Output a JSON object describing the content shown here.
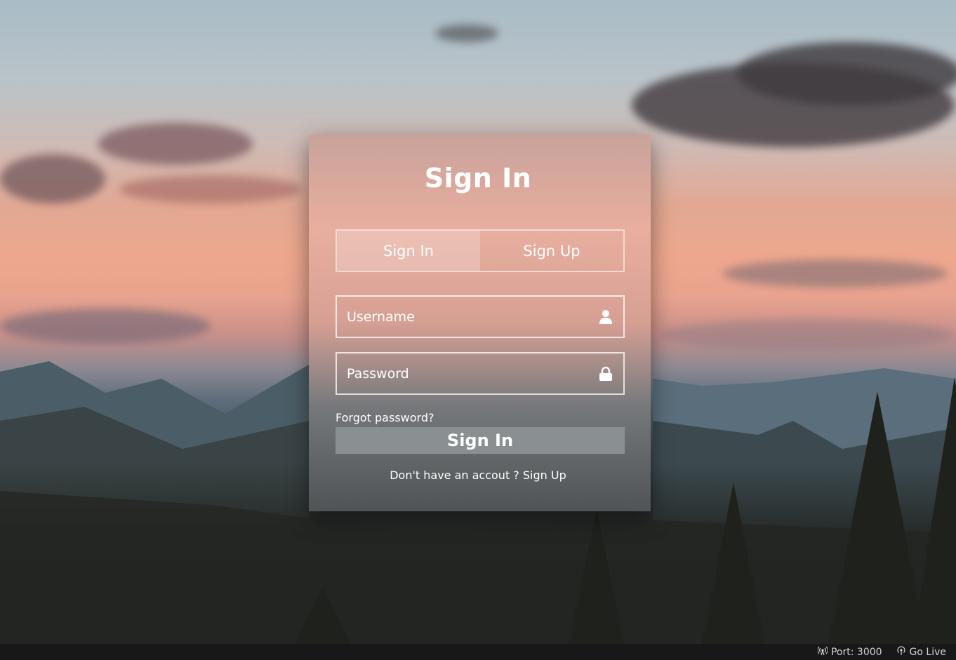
{
  "card": {
    "title": "Sign In",
    "tabs": [
      {
        "label": "Sign In",
        "active": true
      },
      {
        "label": "Sign Up",
        "active": false
      }
    ],
    "username": {
      "placeholder": "Username",
      "icon": "user-icon"
    },
    "password": {
      "placeholder": "Password",
      "icon": "lock-icon"
    },
    "forgot_label": "Forgot password?",
    "submit_label": "Sign In",
    "footer_question": "Don't have an accout ?",
    "footer_link": "Sign Up"
  },
  "statusbar": {
    "port_label": "Port: 3000",
    "port_icon": "broadcast-icon",
    "live_label": "Go Live",
    "live_icon": "signal-icon"
  },
  "colors": {
    "button_bg": "#8a9092",
    "text": "#ffffff",
    "statusbar_bg": "#181818"
  }
}
